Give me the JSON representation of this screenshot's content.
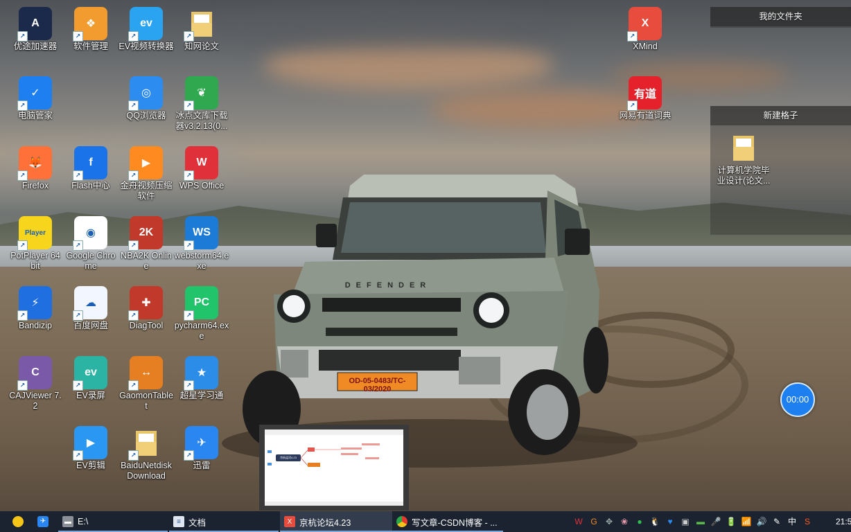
{
  "desktop_icons": [
    {
      "label": "优途加速器",
      "icon": "youtu-accelerator-icon",
      "color": "#1b2a4a"
    },
    {
      "label": "软件管理",
      "icon": "software-manager-icon",
      "color": "#f29b2f"
    },
    {
      "label": "EV视频转换器",
      "icon": "ev-video-converter-icon",
      "color": "#2aa3f0"
    },
    {
      "label": "知网论文",
      "icon": "folder-icon",
      "color": "#e8c46a"
    },
    {
      "label": "电脑管家",
      "icon": "pc-manager-icon",
      "color": "#1e7ff0"
    },
    {
      "label": "QQ浏览器",
      "icon": "qq-browser-icon",
      "color": "#2d8cf0"
    },
    {
      "label": "冰点文库下载器v3.2.13(0...",
      "icon": "bingdian-downloader-icon",
      "color": "#2fa84f"
    },
    {
      "label": "Firefox",
      "icon": "firefox-icon",
      "color": "#ff7139"
    },
    {
      "label": "Flash中心",
      "icon": "flash-center-icon",
      "color": "#1a73e8"
    },
    {
      "label": "金舟视频压缩软件",
      "icon": "jinzhou-video-compressor-icon",
      "color": "#ff8a1f"
    },
    {
      "label": "WPS Office",
      "icon": "wps-office-icon",
      "color": "#e0303a"
    },
    {
      "label": "PotPlayer 64 bit",
      "icon": "potplayer-icon",
      "color": "#f6d51c"
    },
    {
      "label": "Google Chrome",
      "icon": "chrome-icon",
      "color": "#ffffff"
    },
    {
      "label": "NBA2K Online",
      "icon": "nba2k-online-icon",
      "color": "#c0392b"
    },
    {
      "label": "webstorm64.exe",
      "icon": "webstorm-icon",
      "color": "#1b7bd6"
    },
    {
      "label": "Bandizip",
      "icon": "bandizip-icon",
      "color": "#1f6fe0"
    },
    {
      "label": "百度网盘",
      "icon": "baidu-netdisk-icon",
      "color": "#f2f6ff"
    },
    {
      "label": "DiagTool",
      "icon": "diagtool-icon",
      "color": "#c0392b"
    },
    {
      "label": "pycharm64.exe",
      "icon": "pycharm-icon",
      "color": "#21c46b"
    },
    {
      "label": "CAJViewer 7.2",
      "icon": "cajviewer-icon",
      "color": "#7a5aa8"
    },
    {
      "label": "EV录屏",
      "icon": "ev-recorder-icon",
      "color": "#2bb3a3"
    },
    {
      "label": "GaomonTablet",
      "icon": "gaomon-tablet-icon",
      "color": "#e67e22"
    },
    {
      "label": "超星学习通",
      "icon": "chaoxing-icon",
      "color": "#2b8de8"
    },
    {
      "label": "EV剪辑",
      "icon": "ev-editor-icon",
      "color": "#2a97f2"
    },
    {
      "label": "BaiduNetdiskDownload",
      "icon": "folder-icon",
      "color": "#e8c46a"
    },
    {
      "label": "迅雷",
      "icon": "xunlei-icon",
      "color": "#2a86f0"
    },
    {
      "label": "XMind",
      "icon": "xmind-icon",
      "color": "#e74c3c"
    },
    {
      "label": "网易有道词典",
      "icon": "youdao-dict-icon",
      "color": "#e5212b"
    }
  ],
  "icon_glyphs": {
    "a0": "A",
    "a1": "❖",
    "a2": "ev",
    "a3": "",
    "a4": "✓",
    "a5": "◎",
    "a6": "❦",
    "a7": "🦊",
    "a8": "f",
    "a9": "▶",
    "a10": "W",
    "a11": "Player",
    "a12": "◉",
    "a13": "2K",
    "a14": "WS",
    "a15": "⚡",
    "a16": "☁",
    "a17": "✚",
    "a18": "PC",
    "a19": "C",
    "a20": "ev",
    "a21": "↔",
    "a22": "★",
    "a23": "▶",
    "a24": "",
    "a25": "✈",
    "a26": "X",
    "a27": "有道"
  },
  "fences": [
    {
      "title": "我的文件夹",
      "items": []
    },
    {
      "title": "新建格子",
      "items": [
        {
          "label": "计算机学院毕业设计(论文...",
          "icon": "folder-icon"
        }
      ]
    }
  ],
  "car": {
    "plate": "OD-05-0483/TC-03/2020",
    "grille": "DEFENDER"
  },
  "timer": {
    "text": "00:00"
  },
  "preview": {
    "close": "×",
    "node_label": "京杭运河4.23"
  },
  "taskbar": {
    "items": [
      {
        "label": "E:\\",
        "icon": "drive-icon"
      },
      {
        "label": "文档",
        "icon": "document-icon"
      },
      {
        "label": "京杭论坛4.23",
        "icon": "xmind-icon"
      },
      {
        "label": "写文章-CSDN博客 - ...",
        "icon": "chrome-icon"
      }
    ],
    "tray": [
      "W",
      "G",
      "✥",
      "❀",
      "●",
      "🐧",
      "♥",
      "▣",
      "▬",
      "🎤",
      "🔋",
      "📶",
      "🔊",
      "✎",
      "中",
      "S"
    ],
    "clock": "21:5"
  }
}
